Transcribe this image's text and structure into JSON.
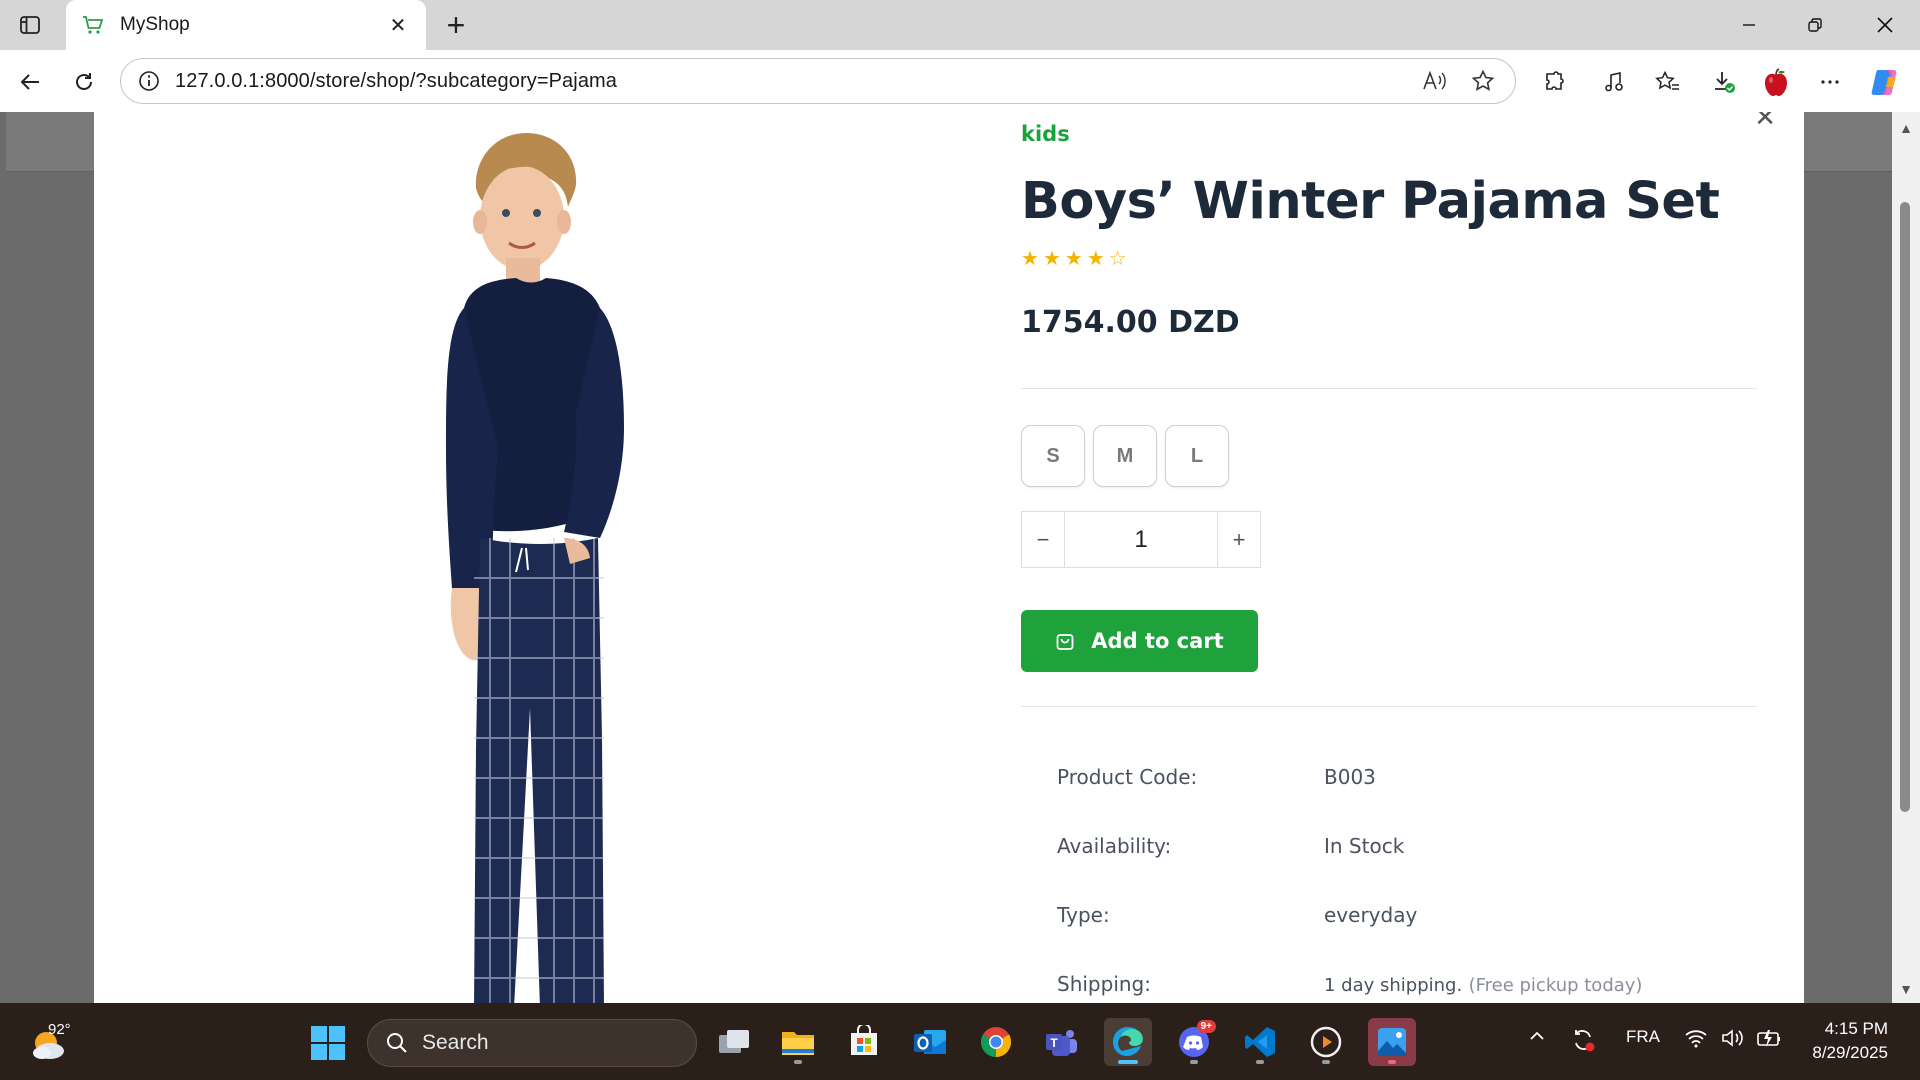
{
  "browser": {
    "tab_title": "MyShop",
    "url": "127.0.0.1:8000/store/shop/?subcategory=Pajama"
  },
  "product": {
    "category": "kids",
    "title": "Boys’ Winter Pajama Set",
    "rating": 4,
    "rating_max": 5,
    "price": "1754.00 DZD",
    "sizes": [
      "S",
      "M",
      "L"
    ],
    "quantity": "1",
    "qty_minus": "−",
    "qty_plus": "+",
    "add_to_cart_label": "Add to cart",
    "specs": [
      {
        "label": "Product Code:",
        "value": "B003"
      },
      {
        "label": "Availability:",
        "value": "In Stock"
      },
      {
        "label": "Type:",
        "value": "everyday"
      },
      {
        "label": "Shipping:",
        "value": "1 day shipping.",
        "note": "(Free pickup today)"
      }
    ]
  },
  "taskbar": {
    "temperature": "92°",
    "search_label": "Search",
    "discord_badge": "9+",
    "language": "FRA",
    "time": "4:15 PM",
    "date": "8/29/2025"
  },
  "colors": {
    "accent_green": "#1fa23b",
    "star_yellow": "#f5b301",
    "title_navy": "#1d2a3a"
  }
}
